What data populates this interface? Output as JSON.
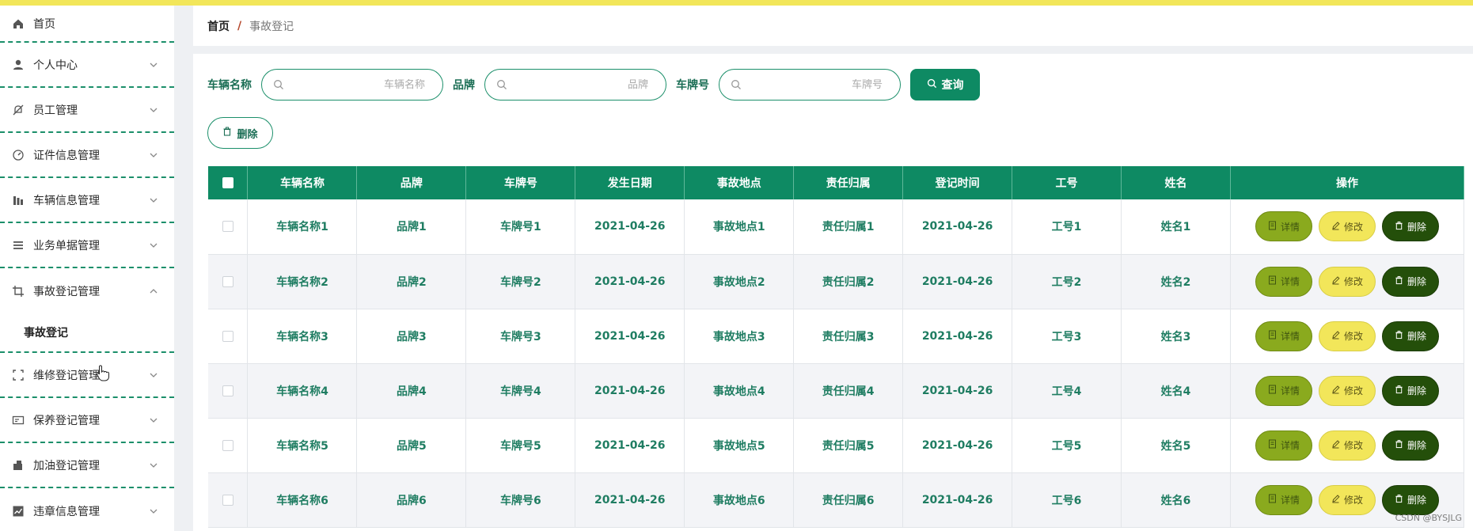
{
  "colors": {
    "topbar": "#f2e65a",
    "accent": "#0e8a63",
    "detail": "#8aaa1e",
    "edit": "#f2e65a",
    "delete": "#244f0a"
  },
  "sidebar": {
    "items": [
      {
        "label": "首页",
        "icon": "home-icon",
        "chevron": "none"
      },
      {
        "label": "个人中心",
        "icon": "user-icon",
        "chevron": "down"
      },
      {
        "label": "员工管理",
        "icon": "bell-off-icon",
        "chevron": "down"
      },
      {
        "label": "证件信息管理",
        "icon": "gauge-icon",
        "chevron": "down"
      },
      {
        "label": "车辆信息管理",
        "icon": "bars-icon",
        "chevron": "down"
      },
      {
        "label": "业务单据管理",
        "icon": "menu-icon",
        "chevron": "down"
      },
      {
        "label": "事故登记管理",
        "icon": "crop-icon",
        "chevron": "up"
      },
      {
        "label": "维修登记管理",
        "icon": "fullscreen-icon",
        "chevron": "down"
      },
      {
        "label": "保养登记管理",
        "icon": "card-icon",
        "chevron": "down"
      },
      {
        "label": "加油登记管理",
        "icon": "fuel-icon",
        "chevron": "down"
      },
      {
        "label": "违章信息管理",
        "icon": "chart-icon",
        "chevron": "down"
      }
    ],
    "submenu": {
      "label": "事故登记"
    }
  },
  "breadcrumb": {
    "home": "首页",
    "separator": "/",
    "current": "事故登记"
  },
  "search": {
    "vehicle_name_label": "车辆名称",
    "vehicle_name_placeholder": "车辆名称",
    "brand_label": "品牌",
    "brand_placeholder": "品牌",
    "plate_label": "车牌号",
    "plate_placeholder": "车牌号",
    "query_label": "查询"
  },
  "toolbar": {
    "delete_label": "删除"
  },
  "table": {
    "headers": [
      "车辆名称",
      "品牌",
      "车牌号",
      "发生日期",
      "事故地点",
      "责任归属",
      "登记时间",
      "工号",
      "姓名",
      "操作"
    ],
    "rows": [
      [
        "车辆名称1",
        "品牌1",
        "车牌号1",
        "2021-04-26",
        "事故地点1",
        "责任归属1",
        "2021-04-26",
        "工号1",
        "姓名1"
      ],
      [
        "车辆名称2",
        "品牌2",
        "车牌号2",
        "2021-04-26",
        "事故地点2",
        "责任归属2",
        "2021-04-26",
        "工号2",
        "姓名2"
      ],
      [
        "车辆名称3",
        "品牌3",
        "车牌号3",
        "2021-04-26",
        "事故地点3",
        "责任归属3",
        "2021-04-26",
        "工号3",
        "姓名3"
      ],
      [
        "车辆名称4",
        "品牌4",
        "车牌号4",
        "2021-04-26",
        "事故地点4",
        "责任归属4",
        "2021-04-26",
        "工号4",
        "姓名4"
      ],
      [
        "车辆名称5",
        "品牌5",
        "车牌号5",
        "2021-04-26",
        "事故地点5",
        "责任归属5",
        "2021-04-26",
        "工号5",
        "姓名5"
      ],
      [
        "车辆名称6",
        "品牌6",
        "车牌号6",
        "2021-04-26",
        "事故地点6",
        "责任归属6",
        "2021-04-26",
        "工号6",
        "姓名6"
      ]
    ],
    "actions": {
      "detail": "详情",
      "edit": "修改",
      "delete": "删除"
    }
  },
  "watermark": "CSDN @BYSJLG"
}
